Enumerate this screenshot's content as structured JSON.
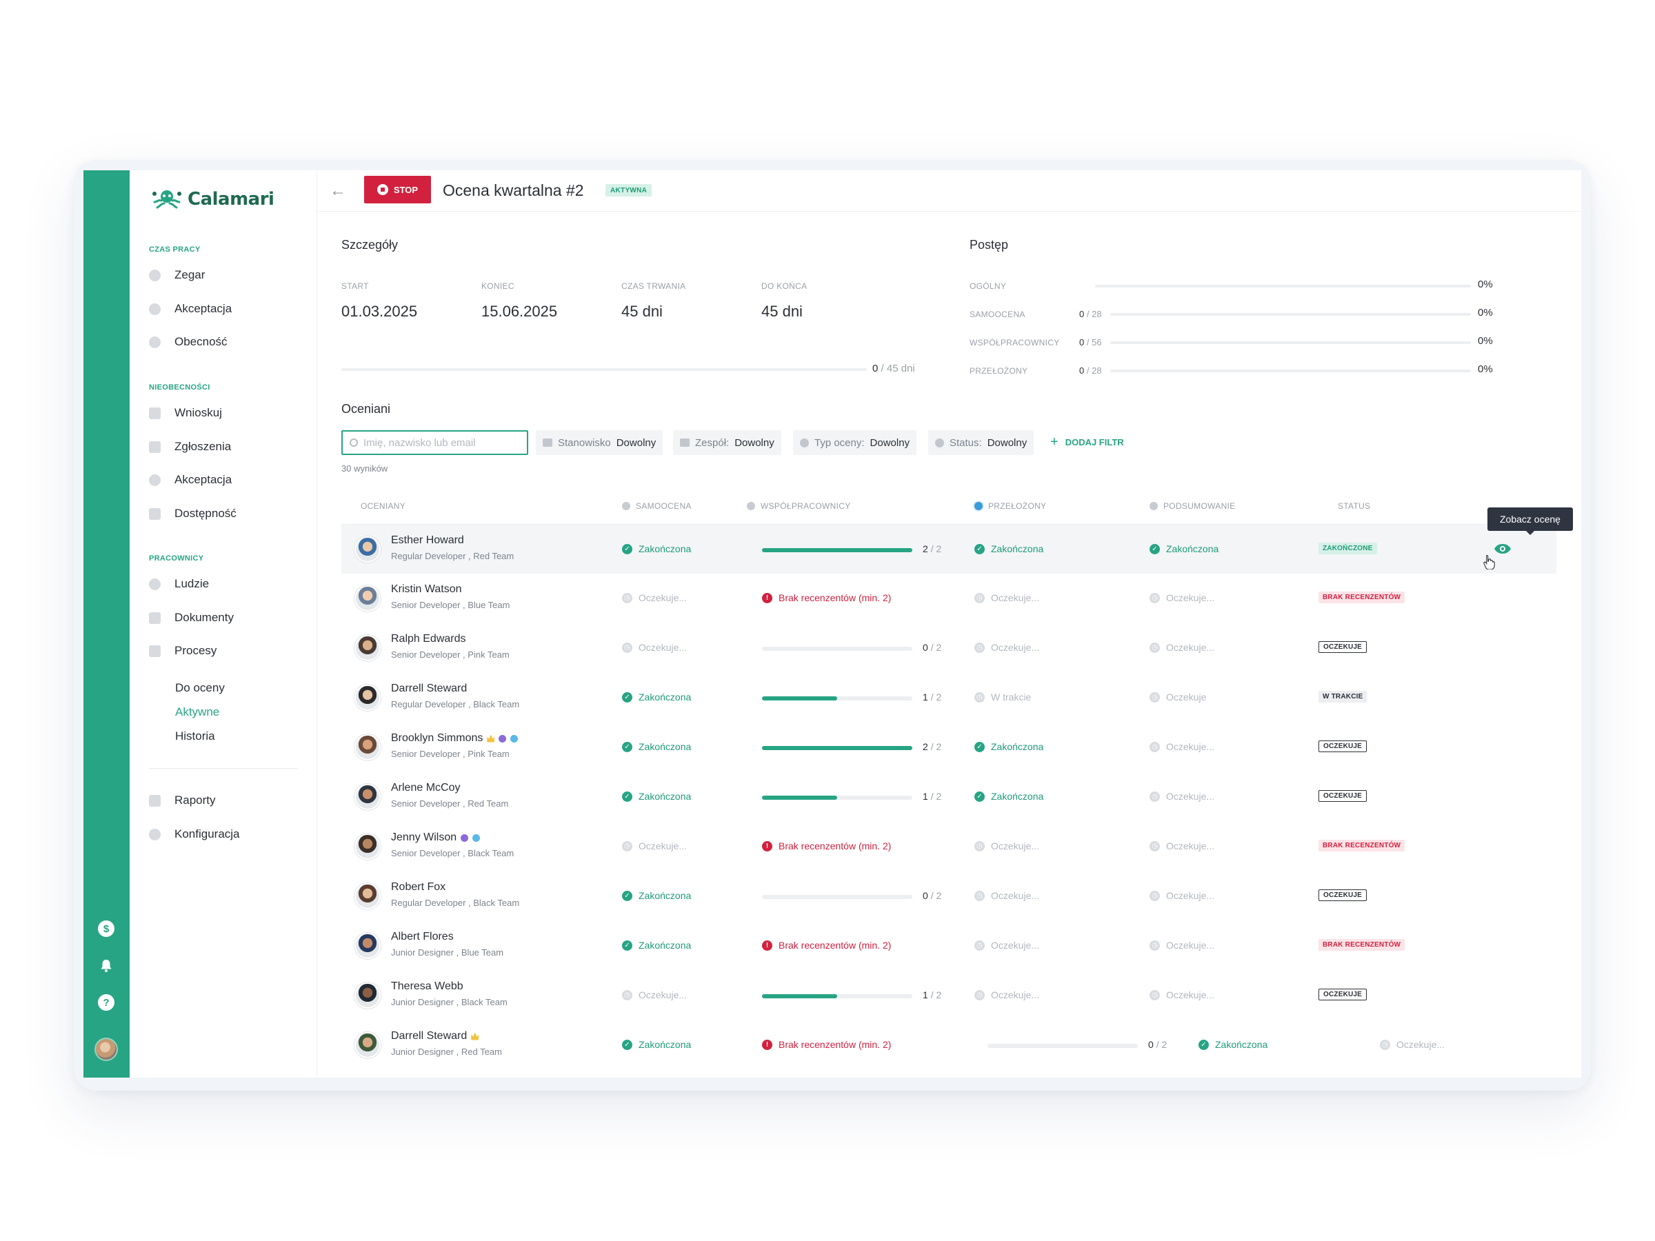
{
  "brand": {
    "name": "Calamari",
    "accent": "#27a484",
    "danger": "#d1213f"
  },
  "sidebar": {
    "sections": [
      {
        "title": "CZAS PRACY",
        "items": [
          "Zegar",
          "Akceptacja",
          "Obecność"
        ]
      },
      {
        "title": "NIEOBECNOŚCI",
        "items": [
          "Wnioskuj",
          "Zgłoszenia",
          "Akceptacja",
          "Dostępność"
        ]
      },
      {
        "title": "PRACOWNICY",
        "items": [
          "Ludzie",
          "Dokumenty",
          "Procesy"
        ]
      }
    ],
    "sub_items": [
      "Do oceny",
      "Aktywne",
      "Historia"
    ],
    "active_sub": "Aktywne",
    "bottom_items": [
      "Raporty",
      "Konfiguracja"
    ]
  },
  "header": {
    "stop_label": "STOP",
    "title": "Ocena kwartalna #2",
    "badge": "AKTYWNA"
  },
  "details": {
    "title": "Szczegóły",
    "fields": [
      {
        "label": "START",
        "value": "01.03.2025"
      },
      {
        "label": "KONIEC",
        "value": "15.06.2025"
      },
      {
        "label": "CZAS TRWANIA",
        "value": "45 dni"
      },
      {
        "label": "DO KOŃCA",
        "value": "45 dni"
      }
    ],
    "duration_done": "0",
    "duration_total": "/ 45 dni",
    "duration_fraction": 0
  },
  "progress": {
    "title": "Postęp",
    "rows": [
      {
        "label": "OGÓLNY",
        "count_done": "",
        "count_total": "",
        "percent": "0%",
        "fraction": 0
      },
      {
        "label": "SAMOOCENA",
        "count_done": "0",
        "count_total": "/ 28",
        "percent": "0%",
        "fraction": 0
      },
      {
        "label": "WSPÓŁPRACOWNICY",
        "count_done": "0",
        "count_total": "/ 56",
        "percent": "0%",
        "fraction": 0
      },
      {
        "label": "PRZEŁOŻONY",
        "count_done": "0",
        "count_total": "/ 28",
        "percent": "0%",
        "fraction": 0
      }
    ]
  },
  "list": {
    "title": "Oceniani",
    "search_placeholder": "Imię, nazwisko lub email",
    "filters": [
      {
        "key": "Stanowisko",
        "value": "Dowolny"
      },
      {
        "key": "Zespół:",
        "value": "Dowolny"
      },
      {
        "key": "Typ oceny:",
        "value": "Dowolny"
      },
      {
        "key": "Status:",
        "value": "Dowolny"
      }
    ],
    "add_filter": "DODAJ FILTR",
    "results": "30 wyników",
    "columns": [
      "OCENIANY",
      "SAMOOCENA",
      "WSPÓŁPRACOWNICY",
      "PRZEŁOŻONY",
      "PODSUMOWANIE",
      "STATUS"
    ],
    "tooltip": "Zobacz ocenę",
    "rows": [
      {
        "name": "Esther Howard",
        "role": "Regular Developer , Red Team",
        "self": "Zakończona",
        "self_state": "ok",
        "peers_type": "bar",
        "peers_done": "2",
        "peers_total": "/ 2",
        "peers_fraction": 1,
        "mgr": "Zakończona",
        "mgr_state": "ok",
        "summary": "Zakończona",
        "summary_state": "ok",
        "status": "ZAKOŃCZONE",
        "status_type": "done",
        "badges": []
      },
      {
        "name": "Kristin Watson",
        "role": "Senior Developer , Blue Team",
        "self": "Oczekuje...",
        "self_state": "wait",
        "peers_type": "error",
        "peers_error": "Brak recenzentów (min. 2)",
        "mgr": "Oczekuje...",
        "mgr_state": "wait",
        "summary": "Oczekuje...",
        "summary_state": "wait",
        "status": "BRAK RECENZENTÓW",
        "status_type": "none",
        "badges": []
      },
      {
        "name": "Ralph Edwards",
        "role": "Senior Developer , Pink Team",
        "self": "Oczekuje...",
        "self_state": "wait",
        "peers_type": "bar",
        "peers_done": "0",
        "peers_total": "/ 2",
        "peers_fraction": 0,
        "mgr": "Oczekuje...",
        "mgr_state": "wait",
        "summary": "Oczekuje...",
        "summary_state": "wait",
        "status": "OCZEKUJE",
        "status_type": "wait",
        "badges": []
      },
      {
        "name": "Darrell Steward",
        "role": "Regular Developer , Black Team",
        "self": "Zakończona",
        "self_state": "ok",
        "peers_type": "bar",
        "peers_done": "1",
        "peers_total": "/ 2",
        "peers_fraction": 0.5,
        "mgr": "W trakcie",
        "mgr_state": "wait",
        "summary": "Oczekuje",
        "summary_state": "wait",
        "status": "W TRAKCIE",
        "status_type": "prog",
        "badges": []
      },
      {
        "name": "Brooklyn Simmons",
        "role": "Senior Developer , Pink Team",
        "self": "Zakończona",
        "self_state": "ok",
        "peers_type": "bar",
        "peers_done": "2",
        "peers_total": "/ 2",
        "peers_fraction": 1,
        "mgr": "Zakończona",
        "mgr_state": "ok",
        "summary": "Oczekuje...",
        "summary_state": "wait",
        "status": "OCZEKUJE",
        "status_type": "wait",
        "badges": [
          "crown-icon",
          "purple-badge-icon",
          "blue-badge-icon"
        ]
      },
      {
        "name": "Arlene McCoy",
        "role": "Senior Developer , Red Team",
        "self": "Zakończona",
        "self_state": "ok",
        "peers_type": "bar",
        "peers_done": "1",
        "peers_total": "/ 2",
        "peers_fraction": 0.5,
        "mgr": "Zakończona",
        "mgr_state": "ok",
        "summary": "Oczekuje...",
        "summary_state": "wait",
        "status": "OCZEKUJE",
        "status_type": "wait",
        "badges": []
      },
      {
        "name": "Jenny Wilson",
        "role": "Senior Developer , Black Team",
        "self": "Oczekuje...",
        "self_state": "wait",
        "peers_type": "error",
        "peers_error": "Brak recenzentów (min. 2)",
        "mgr": "Oczekuje...",
        "mgr_state": "wait",
        "summary": "Oczekuje...",
        "summary_state": "wait",
        "status": "BRAK RECENZENTÓW",
        "status_type": "none",
        "badges": [
          "purple-badge-icon",
          "blue-badge-icon"
        ]
      },
      {
        "name": "Robert Fox",
        "role": "Regular Developer , Black Team",
        "self": "Zakończona",
        "self_state": "ok",
        "peers_type": "bar",
        "peers_done": "0",
        "peers_total": "/ 2",
        "peers_fraction": 0,
        "mgr": "Oczekuje...",
        "mgr_state": "wait",
        "summary": "Oczekuje...",
        "summary_state": "wait",
        "status": "OCZEKUJE",
        "status_type": "wait",
        "badges": []
      },
      {
        "name": "Albert Flores",
        "role": "Junior Designer , Blue Team",
        "self": "Zakończona",
        "self_state": "ok",
        "peers_type": "error",
        "peers_error": "Brak recenzentów (min. 2)",
        "mgr": "Oczekuje...",
        "mgr_state": "wait",
        "summary": "Oczekuje...",
        "summary_state": "wait",
        "status": "BRAK RECENZENTÓW",
        "status_type": "none",
        "badges": []
      },
      {
        "name": "Theresa Webb",
        "role": "Junior Designer , Black Team",
        "self": "Oczekuje...",
        "self_state": "wait",
        "peers_type": "bar",
        "peers_done": "1",
        "peers_total": "/ 2",
        "peers_fraction": 0.5,
        "mgr": "Oczekuje...",
        "mgr_state": "wait",
        "summary": "Oczekuje...",
        "summary_state": "wait",
        "status": "OCZEKUJE",
        "status_type": "wait",
        "badges": []
      },
      {
        "name": "Darrell Steward",
        "role": "Junior Designer , Red Team",
        "self": "Zakończona",
        "self_state": "ok",
        "peers_type": "error",
        "peers_error": "Brak recenzentów (min. 2)",
        "mgr_type": "bar",
        "mgr_done": "0",
        "mgr_total": "/ 2",
        "mgr_fraction": 0,
        "summary": "Zakończona",
        "summary_state": "ok",
        "status": "Oczekuje...",
        "status_type": "text-wait",
        "badges": [
          "crown-icon"
        ]
      }
    ]
  }
}
